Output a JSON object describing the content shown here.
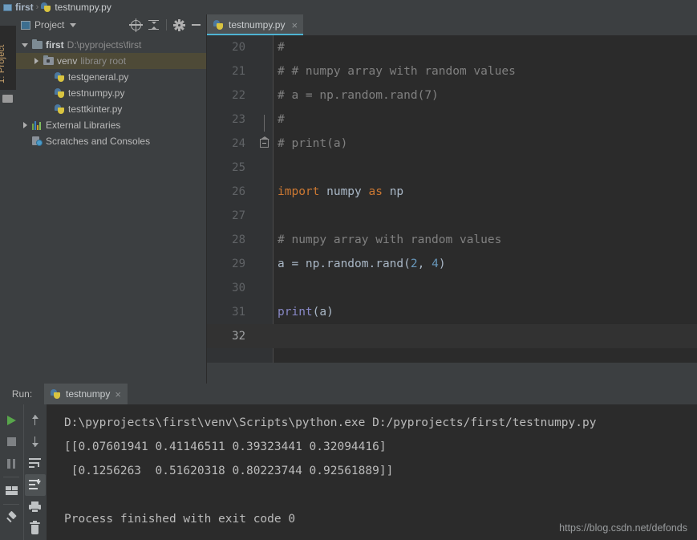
{
  "breadcrumb": {
    "project": "first",
    "separator": "›",
    "file": "testnumpy.py",
    "project_icon": "module-icon",
    "file_icon": "python-file-icon"
  },
  "left_strip": {
    "project_tab_label": "1: Project"
  },
  "project_panel": {
    "title": "Project",
    "tools": [
      {
        "name": "locate-icon",
        "label": "Select Opened File"
      },
      {
        "name": "collapse-all-icon",
        "label": "Collapse All"
      },
      {
        "name": "gear-icon",
        "label": "Settings"
      },
      {
        "name": "minimize-icon",
        "label": "Hide"
      }
    ],
    "tree": [
      {
        "indent": 0,
        "arrow": "down",
        "icon": "folder-icon",
        "label": "first",
        "hint": "D:\\pyprojects\\first",
        "bold": true,
        "selected": false
      },
      {
        "indent": 1,
        "arrow": "right",
        "icon": "venv-folder-icon",
        "label": "venv",
        "hint": "library root",
        "bold": false,
        "selected": true
      },
      {
        "indent": 2,
        "arrow": "none",
        "icon": "python-file-icon",
        "label": "testgeneral.py",
        "hint": "",
        "bold": false,
        "selected": false
      },
      {
        "indent": 2,
        "arrow": "none",
        "icon": "python-file-icon",
        "label": "testnumpy.py",
        "hint": "",
        "bold": false,
        "selected": false
      },
      {
        "indent": 2,
        "arrow": "none",
        "icon": "python-file-icon",
        "label": "testtkinter.py",
        "hint": "",
        "bold": false,
        "selected": false
      },
      {
        "indent": 0,
        "arrow": "right",
        "icon": "external-libraries-icon",
        "label": "External Libraries",
        "hint": "",
        "bold": false,
        "selected": false
      },
      {
        "indent": 0,
        "arrow": "none",
        "icon": "scratches-icon",
        "label": "Scratches and Consoles",
        "hint": "",
        "bold": false,
        "selected": false
      }
    ]
  },
  "editor": {
    "tab": {
      "label": "testnumpy.py",
      "close": "×",
      "icon": "python-file-icon",
      "active": true
    },
    "lines": [
      {
        "num": "20",
        "caret": false,
        "fold": false,
        "tokens": [
          {
            "t": "#",
            "c": "cmt"
          }
        ]
      },
      {
        "num": "21",
        "caret": false,
        "fold": false,
        "tokens": [
          {
            "t": "# # numpy array with random values",
            "c": "cmt"
          }
        ]
      },
      {
        "num": "22",
        "caret": false,
        "fold": false,
        "tokens": [
          {
            "t": "# a = np.random.rand(7)",
            "c": "cmt"
          }
        ]
      },
      {
        "num": "23",
        "caret": false,
        "fold": false,
        "tokens": [
          {
            "t": "#",
            "c": "cmt"
          }
        ]
      },
      {
        "num": "24",
        "caret": false,
        "fold": true,
        "tokens": [
          {
            "t": "# print(a)",
            "c": "cmt"
          }
        ]
      },
      {
        "num": "25",
        "caret": false,
        "fold": false,
        "tokens": []
      },
      {
        "num": "26",
        "caret": false,
        "fold": false,
        "tokens": [
          {
            "t": "import",
            "c": "kw"
          },
          {
            "t": " numpy ",
            "c": "idt"
          },
          {
            "t": "as",
            "c": "kw"
          },
          {
            "t": " np",
            "c": "idt"
          }
        ]
      },
      {
        "num": "27",
        "caret": false,
        "fold": false,
        "tokens": []
      },
      {
        "num": "28",
        "caret": false,
        "fold": false,
        "tokens": [
          {
            "t": "# numpy array with random values",
            "c": "cmt"
          }
        ]
      },
      {
        "num": "29",
        "caret": false,
        "fold": false,
        "tokens": [
          {
            "t": "a = np.random.rand",
            "c": "idt"
          },
          {
            "t": "(",
            "c": "idt"
          },
          {
            "t": "2",
            "c": "num-lit"
          },
          {
            "t": ", ",
            "c": "idt"
          },
          {
            "t": "4",
            "c": "num-lit"
          },
          {
            "t": ")",
            "c": "idt"
          }
        ]
      },
      {
        "num": "30",
        "caret": false,
        "fold": false,
        "tokens": []
      },
      {
        "num": "31",
        "caret": false,
        "fold": false,
        "tokens": [
          {
            "t": "print",
            "c": "fn"
          },
          {
            "t": "(a)",
            "c": "idt"
          }
        ]
      },
      {
        "num": "32",
        "caret": true,
        "fold": false,
        "tokens": []
      }
    ]
  },
  "run_panel": {
    "label": "Run:",
    "tab": {
      "label": "testnumpy",
      "close": "×",
      "icon": "python-file-icon"
    },
    "tools_left": [
      {
        "name": "run-icon",
        "label": "Rerun",
        "active": false
      },
      {
        "name": "stop-icon",
        "label": "Stop",
        "active": false
      },
      {
        "name": "pause-icon",
        "label": "Pause Output",
        "active": false
      },
      {
        "name": "layout-icon",
        "label": "Restore Layout",
        "active": false
      },
      {
        "name": "pin-icon",
        "label": "Pin Tab",
        "active": false
      }
    ],
    "tools_right": [
      {
        "name": "arrow-up-icon",
        "label": "Up the Stack Trace",
        "active": false
      },
      {
        "name": "arrow-down-icon",
        "label": "Down the Stack Trace",
        "active": false
      },
      {
        "name": "soft-wrap-icon",
        "label": "Use Soft Wraps",
        "active": false
      },
      {
        "name": "scroll-to-end-icon",
        "label": "Scroll to End",
        "active": true
      },
      {
        "name": "print-icon",
        "label": "Print",
        "active": false
      },
      {
        "name": "trash-icon",
        "label": "Clear All",
        "active": false
      }
    ],
    "console": [
      "D:\\pyprojects\\first\\venv\\Scripts\\python.exe D:/pyprojects/first/testnumpy.py",
      "[[0.07601941 0.41146511 0.39323441 0.32094416]",
      " [0.1256263  0.51620318 0.80223744 0.92561889]]",
      "",
      "Process finished with exit code 0"
    ]
  },
  "watermark": "https://blog.csdn.net/defonds",
  "colors": {
    "panel_bg": "#3C3F41",
    "editor_bg": "#2B2B2B",
    "gutter_bg": "#313335",
    "tab_active_bg": "#4E5254",
    "tab_underline": "#4EB3D3",
    "tree_selection": "#4E4A37",
    "keyword": "#CC7832",
    "comment": "#808080",
    "identifier": "#A9B7C6",
    "number": "#6897BB",
    "function": "#8888C6",
    "run_green": "#58A64B"
  }
}
